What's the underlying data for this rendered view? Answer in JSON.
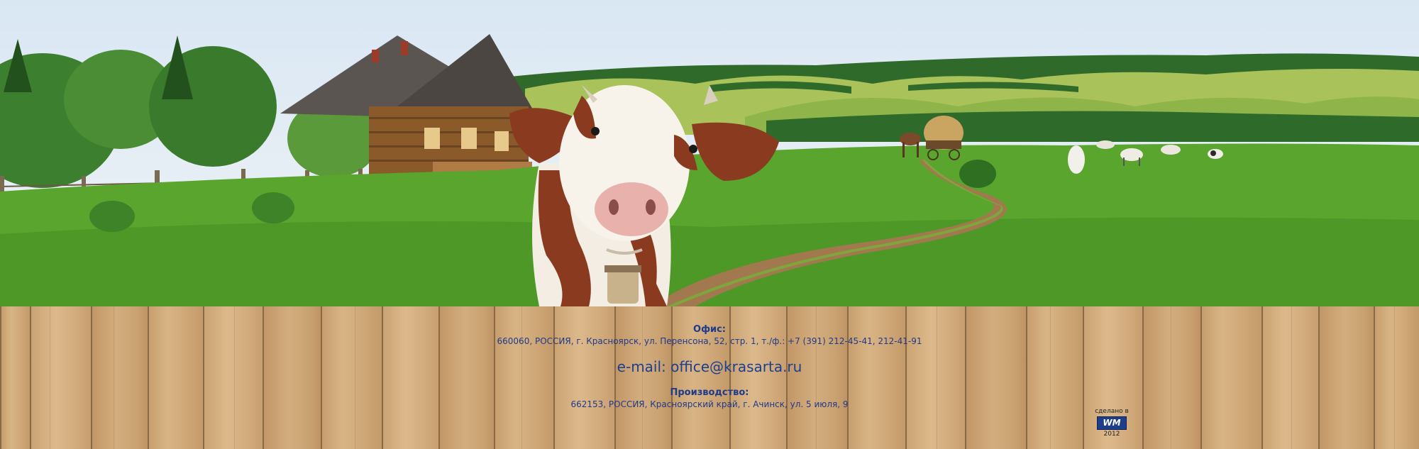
{
  "footer": {
    "office_title": "Офис:",
    "office_address": "660060,  РОССИЯ, г. Красноярск, ул. Перенсона, 52, стр. 1, т./ф.: +7 (391) 212-45-41, 212-41-91",
    "email_prefix": "e-mail: ",
    "email": "office@krasarta.ru",
    "production_title": "Производство:",
    "production_address": "662153, РОССИЯ, Красноярский край, г. Ачинск, ул. 5 июля, 9"
  },
  "credit": {
    "made_by": "сделано в",
    "logo": "WM",
    "year": "2012"
  },
  "colors": {
    "text": "#1e3a8a",
    "grass": "#5aa52e",
    "wood": "#d2ac7d"
  }
}
